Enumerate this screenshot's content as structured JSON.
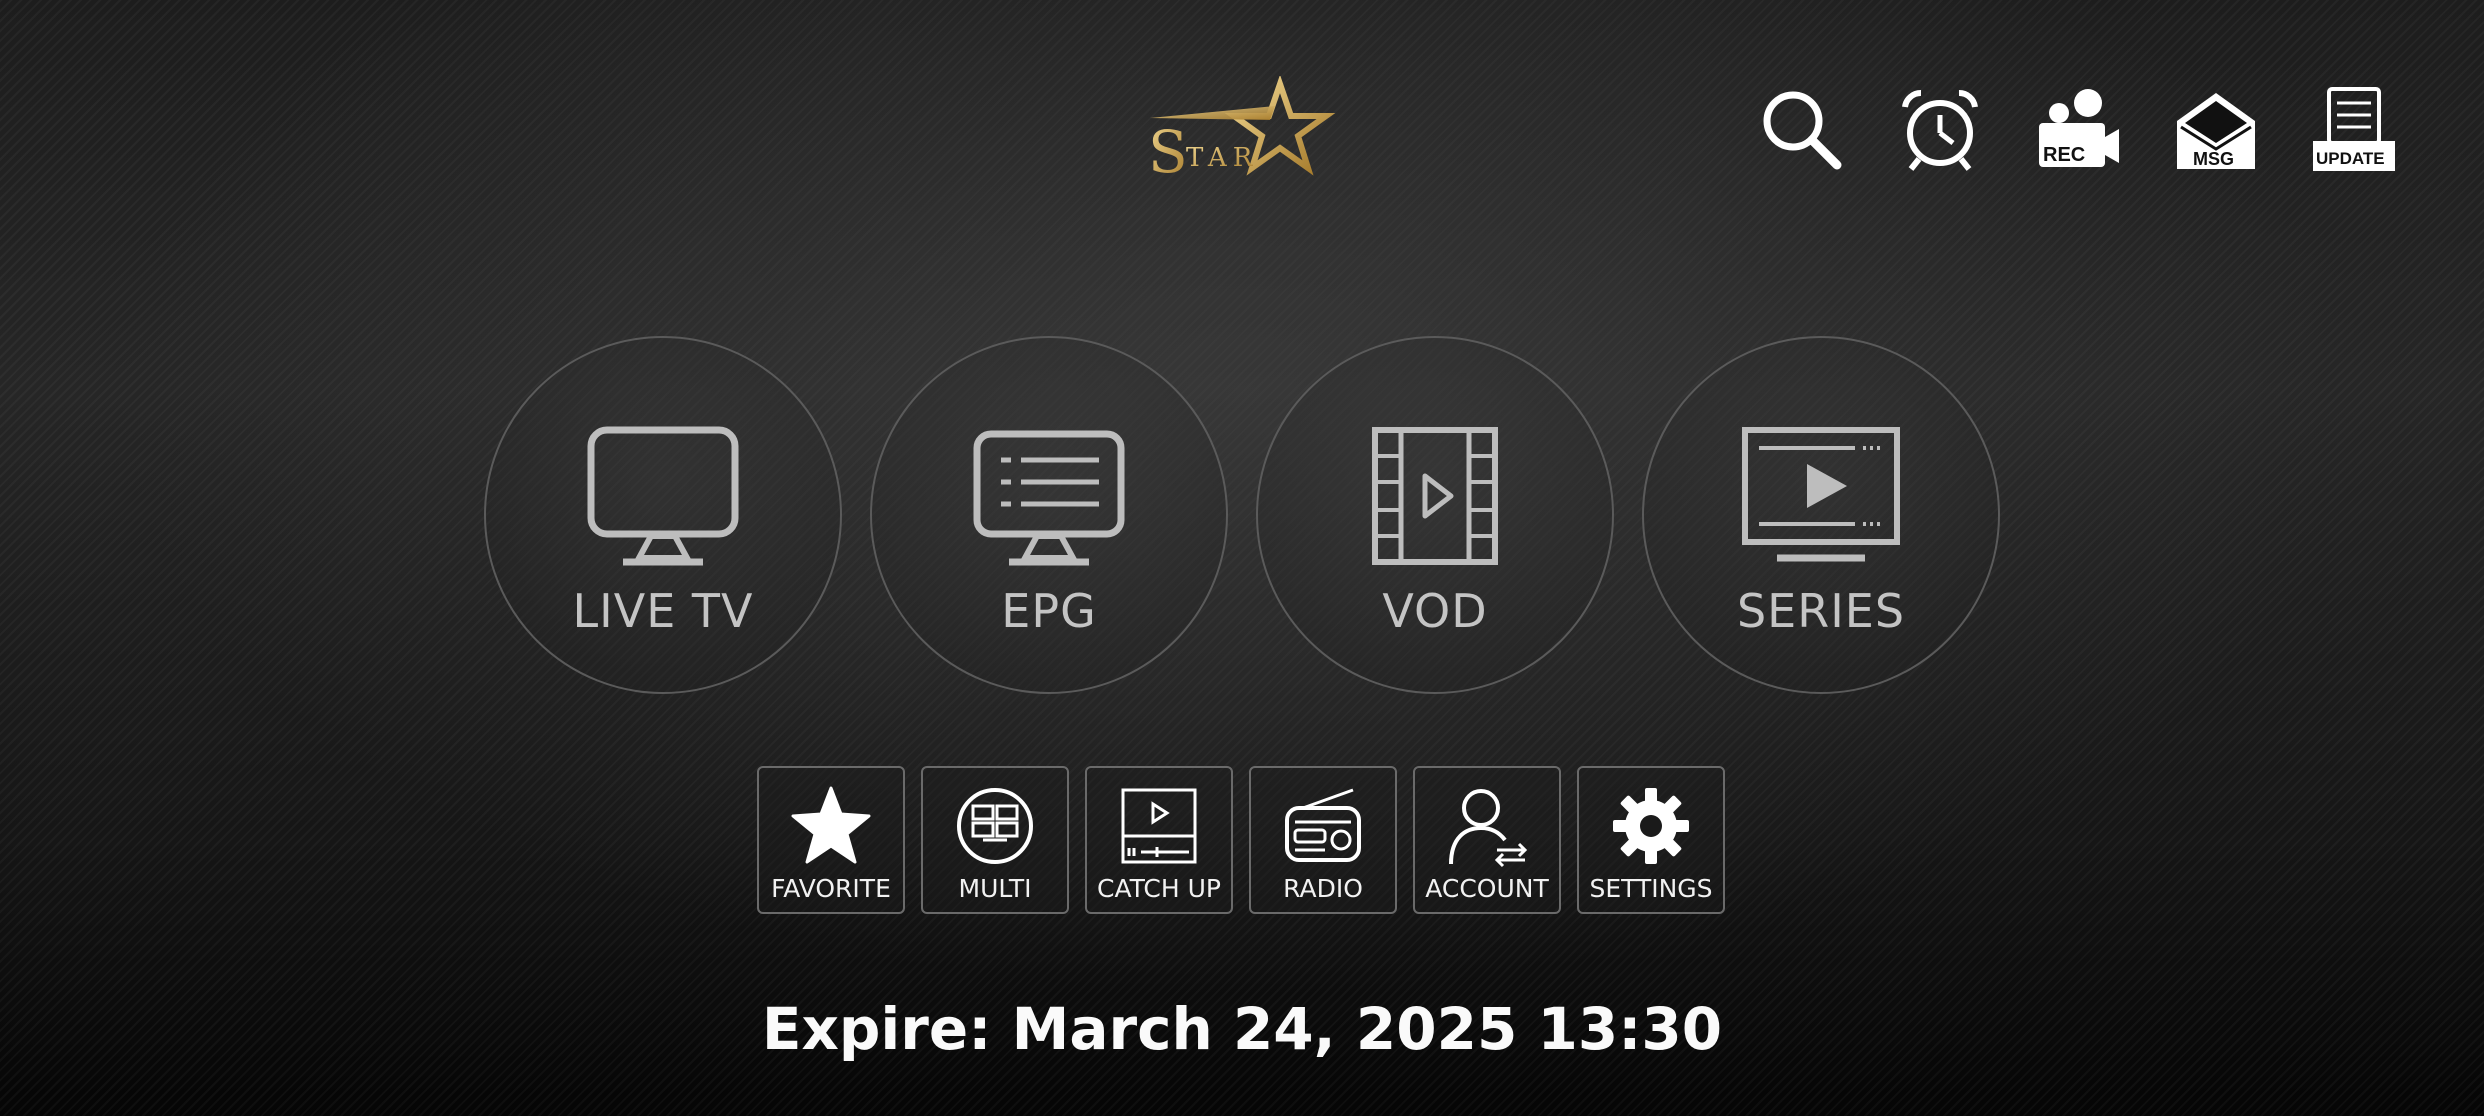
{
  "logo": {
    "text": "STAR"
  },
  "top_icons": [
    {
      "name": "search",
      "label": ""
    },
    {
      "name": "alarm",
      "label": ""
    },
    {
      "name": "rec",
      "label": "REC"
    },
    {
      "name": "msg",
      "label": "MSG"
    },
    {
      "name": "update",
      "label": "UPDATE"
    }
  ],
  "main_menu": [
    {
      "name": "live-tv",
      "label": "LIVE TV"
    },
    {
      "name": "epg",
      "label": "EPG"
    },
    {
      "name": "vod",
      "label": "VOD"
    },
    {
      "name": "series",
      "label": "SERIES"
    }
  ],
  "secondary_menu": [
    {
      "name": "favorite",
      "label": "FAVORITE"
    },
    {
      "name": "multi",
      "label": "MULTI"
    },
    {
      "name": "catch-up",
      "label": "CATCH UP"
    },
    {
      "name": "radio",
      "label": "RADIO"
    },
    {
      "name": "account",
      "label": "ACCOUNT"
    },
    {
      "name": "settings",
      "label": "SETTINGS"
    }
  ],
  "expire_text": "Expire: March 24, 2025 13:30",
  "colors": {
    "logo_gold": "#c9a44c",
    "icon_gray": "#bdbdbd",
    "text_white": "#ffffff"
  }
}
